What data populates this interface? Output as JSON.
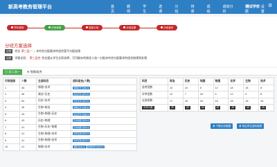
{
  "header": {
    "brand": "新高考教务管理平台",
    "nav": [
      "首页",
      "教师",
      "学生",
      "选课",
      "分班",
      "排课",
      "成绩",
      "成绩分析",
      "数据",
      "设置"
    ],
    "school": "测试学校",
    "settings_icon": "gear-icon"
  },
  "steps": {
    "items": [
      "学科调查",
      "分班参数",
      "智能分班",
      "分班结果",
      "分班宣布"
    ],
    "colors": [
      "#c62828",
      "#43a047",
      "#c62828",
      "#c62828",
      "#c62828"
    ]
  },
  "notice": {
    "title": "分班方案选择",
    "r1_tag": "注意",
    "r1_a": "完全",
    "r1_hl": "第三层一",
    "r1_b": "，本符合分配要求的组合暂不分配加限",
    "r2_tag": "注意",
    "r2_a": "学量全班、",
    "r2_hl": "第三层合",
    "r2_b": "完全遵从学生志愿选择，可可能存的按定二选一分配未符合分配要求的组合按规则处理"
  },
  "tabs": {
    "tab1": "定二选一",
    "tab2": "智能组合"
  },
  "left_table": {
    "headers": [
      "行政班级",
      "人数",
      "主选科目",
      "选科组合[人数]"
    ],
    "rows": [
      {
        "cls": "1",
        "num": "46",
        "subj": "物理+技术",
        "combos": [
          "物理化学 生物[23]"
        ]
      },
      {
        "cls": "2",
        "num": "46",
        "subj": "政治+历史",
        "combos": [
          "政治历史 技术[46]"
        ]
      },
      {
        "cls": "3",
        "num": "50",
        "subj": "历史+技术",
        "combos": [
          "历史化学 技术[50]"
        ]
      },
      {
        "cls": "4",
        "num": "46",
        "subj": "生物+政治",
        "combos": [
          "物理化学 生物[46]"
        ]
      },
      {
        "cls": "5",
        "num": "43",
        "subj": "生物+物理+历史",
        "combos": [
          "政治历史 生物[43]"
        ]
      },
      {
        "cls": "6",
        "num": "43",
        "subj": "历史+物理",
        "combos": [
          "历史物理 化学[43]"
        ]
      },
      {
        "cls": "7",
        "num": "41",
        "subj": "生物+历史+物理",
        "combos": [
          "历史物理 化学[41]"
        ]
      },
      {
        "cls": "8",
        "num": "41",
        "subj": "生物+物理+技术",
        "combos": [
          "化学生物 技术[41]"
        ]
      },
      {
        "cls": "9",
        "num": "41",
        "subj": "生物+物理+技术",
        "combos": [
          "化学生物 技术[41]"
        ]
      },
      {
        "cls": "10",
        "num": "41",
        "subj": "物理+技术",
        "combos": [
          "物理 技术[41]",
          "物理化学 技术[15]"
        ]
      }
    ]
  },
  "right_table": {
    "headers": [
      "科目",
      "政治",
      "历史",
      "地理",
      "物理",
      "化学",
      "生物",
      "技术"
    ],
    "rows": [
      {
        "label": "选考班数",
        "vals": [
          "10",
          "10",
          "5",
          "12",
          "18",
          "18",
          "8"
        ]
      },
      {
        "label": "学考班数",
        "vals": [
          "12",
          "7",
          "16",
          "5",
          "12",
          "9",
          "8"
        ]
      },
      {
        "label": "全部班数",
        "vals": [
          "17",
          "16",
          "16",
          "16",
          "18",
          "18",
          "16"
        ]
      }
    ],
    "avg_label": "平均人数",
    "avg_vals": [
      "45",
      "45",
      "45",
      "45",
      "45",
      "45",
      "45"
    ]
  },
  "buttons": {
    "download": "下载分析数据",
    "export": "导出学生选科报表"
  }
}
